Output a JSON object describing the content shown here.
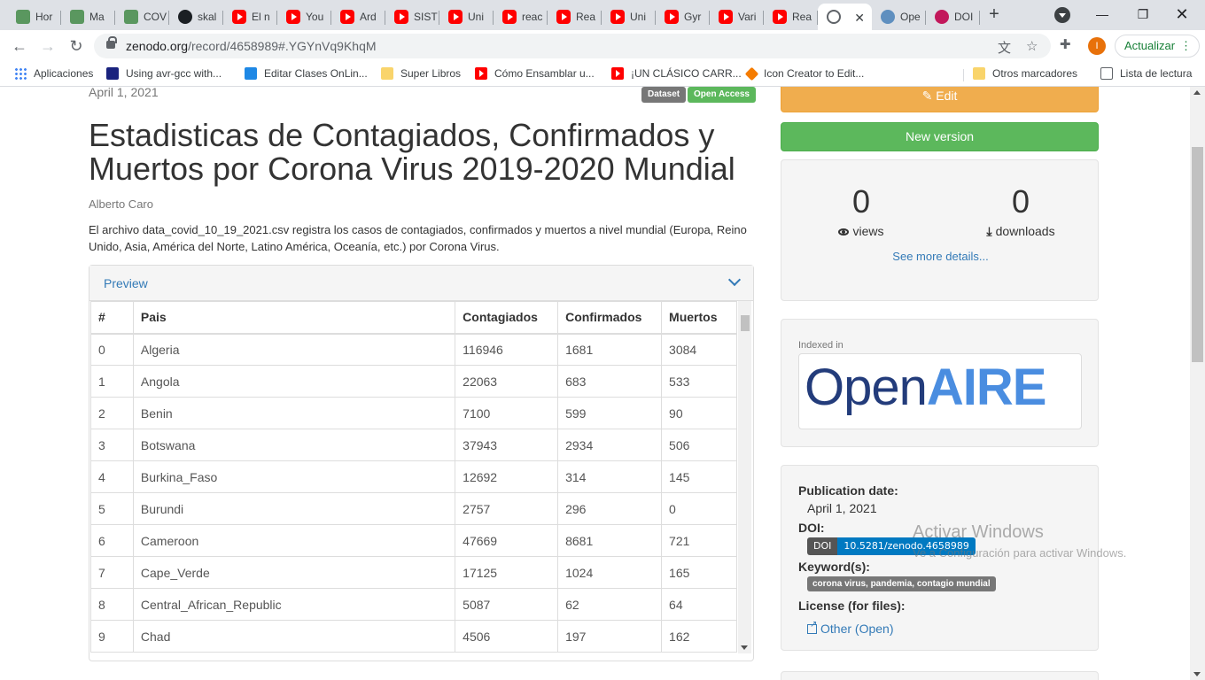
{
  "browser": {
    "tabs": [
      {
        "label": "Hor",
        "icon": "ecdc-icon"
      },
      {
        "label": "Ma",
        "icon": "ecdc-icon"
      },
      {
        "label": "COV",
        "icon": "ecdc-icon"
      },
      {
        "label": "skal",
        "icon": "github-icon"
      },
      {
        "label": "El n",
        "icon": "youtube-icon"
      },
      {
        "label": "You",
        "icon": "youtube-icon"
      },
      {
        "label": "Ard",
        "icon": "youtube-icon"
      },
      {
        "label": "SIST",
        "icon": "youtube-icon"
      },
      {
        "label": "Uni",
        "icon": "youtube-icon"
      },
      {
        "label": "reac",
        "icon": "youtube-icon"
      },
      {
        "label": "Rea",
        "icon": "youtube-icon"
      },
      {
        "label": "Uni",
        "icon": "youtube-icon"
      },
      {
        "label": "Gyr",
        "icon": "youtube-icon"
      },
      {
        "label": "Vari",
        "icon": "youtube-icon"
      },
      {
        "label": "Rea",
        "icon": "youtube-icon"
      },
      {
        "label": "",
        "icon": "globe-icon",
        "active": true
      },
      {
        "label": "Ope",
        "icon": "openaire-icon"
      },
      {
        "label": "DOI",
        "icon": "doi-icon"
      }
    ],
    "url_host": "zenodo.org",
    "url_path": "/record/4658989#.YGYnVq9KhqM",
    "profile_initial": "I",
    "update_label": "Actualizar",
    "bookmarks": [
      {
        "label": "Aplicaciones",
        "icon": "apps-icon"
      },
      {
        "label": "Using avr-gcc with...",
        "icon": "avr-icon"
      },
      {
        "label": "Editar Clases OnLin...",
        "icon": "ie-icon"
      },
      {
        "label": "Super Libros",
        "icon": "folder-icon"
      },
      {
        "label": "Cómo Ensamblar u...",
        "icon": "youtube-icon"
      },
      {
        "label": "¡UN CLÁSICO CARR...",
        "icon": "youtube-icon"
      },
      {
        "label": "Icon Creator to Edit...",
        "icon": "icon-creator-icon"
      }
    ],
    "other_bookmarks": "Otros marcadores",
    "reading_list": "Lista de lectura"
  },
  "record": {
    "pub_date_top": "April 1, 2021",
    "badges": {
      "type": "Dataset",
      "access": "Open Access"
    },
    "title": "Estadisticas de Contagiados, Confirmados y Muertos por Corona Virus 2019-2020 Mundial",
    "author": "Alberto Caro",
    "description": "El archivo data_covid_10_19_2021.csv registra los casos de contagiados, confirmados y muertos a nivel mundial (Europa, Reino Unido, Asia, América del Norte, Latino América, Oceanía, etc.) por Corona Virus."
  },
  "preview": {
    "title": "Preview",
    "columns": [
      "#",
      "Pais",
      "Contagiados",
      "Confirmados",
      "Muertos"
    ],
    "rows": [
      [
        "0",
        "Algeria",
        "116946",
        "1681",
        "3084"
      ],
      [
        "1",
        "Angola",
        "22063",
        "683",
        "533"
      ],
      [
        "2",
        "Benin",
        "7100",
        "599",
        "90"
      ],
      [
        "3",
        "Botswana",
        "37943",
        "2934",
        "506"
      ],
      [
        "4",
        "Burkina_Faso",
        "12692",
        "314",
        "145"
      ],
      [
        "5",
        "Burundi",
        "2757",
        "296",
        "0"
      ],
      [
        "6",
        "Cameroon",
        "47669",
        "8681",
        "721"
      ],
      [
        "7",
        "Cape_Verde",
        "17125",
        "1024",
        "165"
      ],
      [
        "8",
        "Central_African_Republic",
        "5087",
        "62",
        "64"
      ],
      [
        "9",
        "Chad",
        "4506",
        "197",
        "162"
      ]
    ]
  },
  "sidebar": {
    "edit_label": "Edit",
    "new_version_label": "New version",
    "views_count": "0",
    "views_label": "views",
    "downloads_count": "0",
    "downloads_label": "downloads",
    "see_more": "See more details...",
    "indexed_in": "Indexed in",
    "openaire_part1": "Open",
    "openaire_part2": "AIRE",
    "publication_date_label": "Publication date:",
    "publication_date": "April 1, 2021",
    "doi_label": "DOI:",
    "doi_badge_left": "DOI",
    "doi_value": "10.5281/zenodo.4658989",
    "keywords_label": "Keyword(s):",
    "keywords": "corona virus, pandemia, contagio mundial",
    "license_label": "License (for files):",
    "license_value": "Other (Open)"
  },
  "watermark": {
    "title": "Activar Windows",
    "subtitle": "Ve a Configuración para activar Windows."
  },
  "colors": {
    "edit": "#f0ad4e",
    "new_version": "#5cb85c",
    "link": "#337ab7",
    "doi": "#0079c1"
  }
}
